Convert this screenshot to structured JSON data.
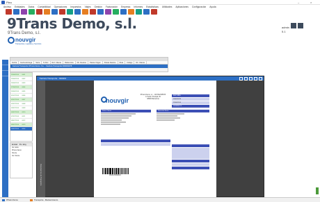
{
  "window": {
    "title": "Pleo",
    "controls": [
      "–",
      "×"
    ]
  },
  "menu": [
    "Archivo",
    "Entidades",
    "Datos",
    "Contabilidad",
    "Operaciones",
    "Impuestos",
    "Viajes",
    "Gestión",
    "Facturación",
    "Empresa",
    "Informes",
    "Estadísticas",
    "Utilidades",
    "Aplicaciones",
    "Configuración",
    "Ayuda"
  ],
  "toolbar_colors": [
    "#c0392b",
    "#2d6fc4",
    "#8e44ad",
    "#27ae60",
    "#c0392b",
    "#e67e22",
    "#2d6fc4",
    "#c0392b",
    "#16a085",
    "#2d6fc4",
    "#e67e22",
    "#c0392b",
    "#2d6fc4",
    "#8e44ad",
    "#27ae60",
    "#2d6fc4",
    "#e67e22",
    "#16a085",
    "#2d6fc4",
    "#c0392b"
  ],
  "company": {
    "name": "9Trans Demo, s.l.",
    "subtitle": "9Trans Demo, s.l.",
    "logo_text": "nouvgir",
    "logo_sub": "Transportes, Logística y Servicios"
  },
  "user": {
    "name": "admin",
    "version": "5.1"
  },
  "subwindow": {
    "tabs": [
      "Fecha",
      "Fecha Entrega",
      "Serie",
      "N.Doc",
      "Ref. Cliente",
      "Referencia",
      "Dir. Destino",
      "Pais/a Origen",
      "País/a Destino",
      "Ruta",
      "Código",
      "Dir. Cliente"
    ],
    "selected_row": "Factura  Transporte  9Trans Demo, S.L.  ·  Factura Transporte 000003478"
  },
  "list_rows": [
    {
      "a": "25/06/2014",
      "b": "0001"
    },
    {
      "a": "25/06/2014",
      "b": "0002"
    },
    {
      "a": "26/06/2014",
      "b": "0003"
    },
    {
      "a": "27/06/2014",
      "b": "0004"
    },
    {
      "a": "30/06/2014",
      "b": "0005"
    },
    {
      "a": "01/07/2014",
      "b": "0006"
    },
    {
      "a": "02/07/2014",
      "b": "0007"
    },
    {
      "a": "02/07/2014",
      "b": "0008"
    },
    {
      "a": "03/07/2014",
      "b": "0009"
    },
    {
      "a": "04/07/2014",
      "b": "0010"
    },
    {
      "a": "07/07/2014",
      "b": "0011"
    },
    {
      "a": "08/07/2014",
      "b": "0012"
    },
    {
      "a": "09/07/2014",
      "b": "0013"
    },
    {
      "a": "10/07/2014",
      "b": "0014"
    }
  ],
  "lower_panel": {
    "header": [
      "Entidad",
      "Pto. Entg."
    ],
    "lines": [
      "Ver todos",
      "9Trans Demo",
      "Cliente",
      "Ver Cliente"
    ]
  },
  "viewer": {
    "title": "Factura Transporte - 000003",
    "side_label": "Documentos de Transporte"
  },
  "invoice": {
    "logo": "nouvgir",
    "address": [
      "9Trans Demo, s.l. - CIF:B12345678",
      "C/ Avda. Principal, 00",
      "08000 Barcelona"
    ],
    "header_labels": [
      "FACTURA",
      "Nº FACTURA",
      "FECHA"
    ],
    "header_values": [
      "000003478",
      "25/06/2014",
      "SEMANA 26"
    ],
    "client_title": "Datos Cliente",
    "ship_title": "Dirección Envío",
    "barcode_number": "0003478000003"
  },
  "taskbar": [
    {
      "label": "9Trans Demo",
      "color": "#2d6fc4"
    },
    {
      "label": "Transporte - Mantenimiento",
      "color": "#e67e22"
    }
  ]
}
